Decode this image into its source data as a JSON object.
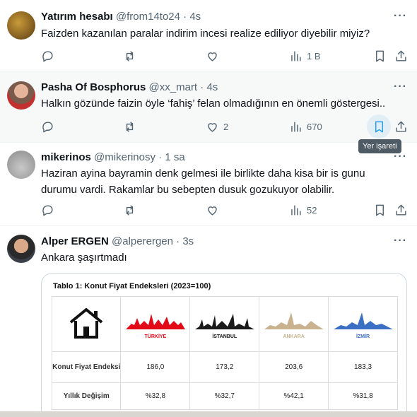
{
  "tweets": [
    {
      "name": "Yatırım hesabı",
      "handle": "@from14to24",
      "dot": "·",
      "time": "4s",
      "text": "Faizden kazanılan paralar indirim incesi realize ediliyor diyebilir miyiz?",
      "replies": "",
      "retweets": "",
      "likes": "",
      "views": "1 B"
    },
    {
      "name": "Pasha Of Bosphorus",
      "handle": "@xx_mart",
      "dot": "·",
      "time": "4s",
      "text": "Halkın gözünde faizin öyle ‘fahiş’ felan olmadığının en önemli göstergesi..",
      "replies": "",
      "retweets": "",
      "likes": "2",
      "views": "670",
      "tooltip": "Yer işareti"
    },
    {
      "name": "mikerinos",
      "handle": "@mikerinosy",
      "dot": "·",
      "time": "1 sa",
      "text": "Haziran ayina bayramin denk gelmesi ile birlikte daha kisa bir is gunu durumu vardi. Rakamlar bu sebepten dusuk gozukuyor olabilir.",
      "replies": "",
      "retweets": "",
      "likes": "",
      "views": "52"
    },
    {
      "name": "Alper ERGEN",
      "handle": "@alperergen",
      "dot": "·",
      "time": "3s",
      "text": "Ankara şaşırtmadı"
    }
  ],
  "media": {
    "title": "Tablo 1: Konut Fiyat Endeksleri (2023=100)",
    "columns": [
      "TÜRKİYE",
      "İSTANBUL",
      "ANKARA",
      "İZMİR"
    ],
    "rows": [
      {
        "label": "Konut Fiyat Endeksi",
        "values": [
          "186,0",
          "173,2",
          "203,6",
          "183,3"
        ]
      },
      {
        "label": "Yıllık Değişim",
        "values": [
          "%32,8",
          "%32,7",
          "%42,1",
          "%31,8"
        ]
      }
    ]
  },
  "colors": {
    "turkiye": "#e30a17",
    "istanbul": "#1a1a1a",
    "ankara": "#c9b28f",
    "izmir": "#3b6fc4",
    "accent": "#1d9bf0"
  }
}
